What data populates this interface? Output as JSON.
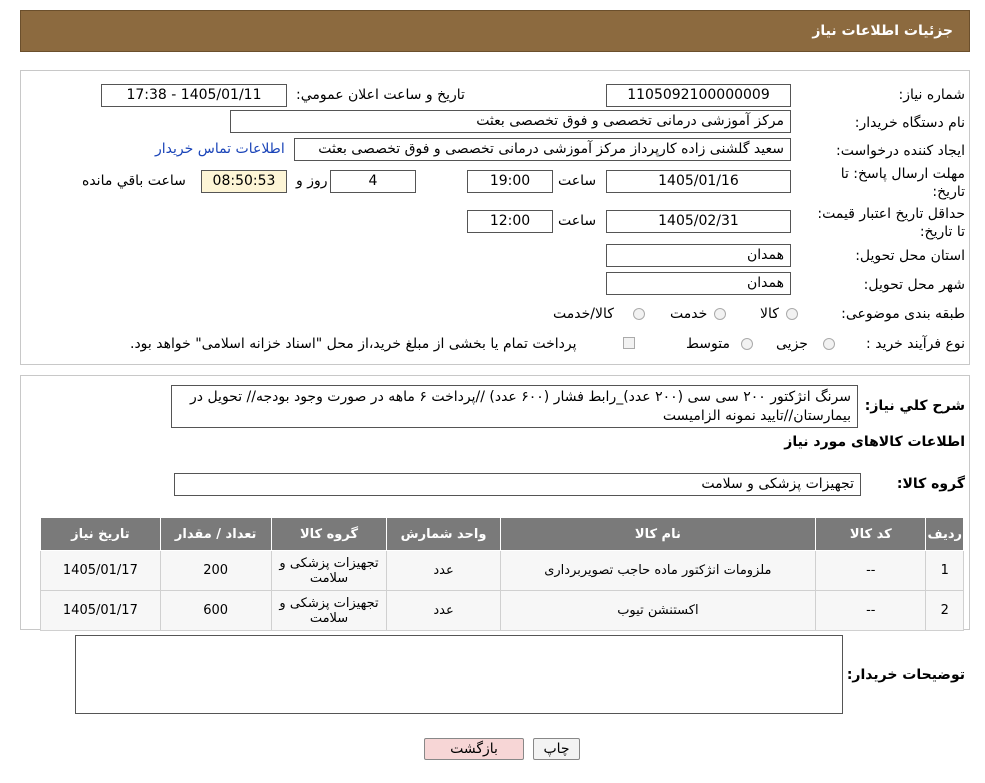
{
  "header": {
    "title": "جزئیات اطلاعات نیاز"
  },
  "form": {
    "need_number_label": "شماره نیاز:",
    "need_number": "1105092100000009",
    "announce_label": "تاریخ و ساعت اعلان عمومي:",
    "announce_value": "1405/01/11 - 17:38",
    "buyer_org_label": "نام دستگاه خريدار:",
    "buyer_org": "مرکز آموزشی درمانی تخصصی و فوق تخصصی بعثت",
    "creator_label": "ايجاد کننده درخواست:",
    "creator": "سعید گلشنی زاده کارپرداز مرکز آموزشی درمانی تخصصی و فوق تخصصی بعثت",
    "contact_link": "اطلاعات تماس خريدار",
    "deadline_label": "مهلت ارسال پاسخ: تا تاریخ:",
    "deadline_date": "1405/01/16",
    "time_label": "ساعت",
    "deadline_time": "19:00",
    "days_value": "4",
    "days_label": "روز و",
    "remaining_time": "08:50:53",
    "remaining_label": "ساعت باقي مانده",
    "validity_label": "حداقل تاريخ اعتبار قيمت: تا تاریخ:",
    "validity_date": "1405/02/31",
    "validity_time": "12:00",
    "province_label": "استان محل تحویل:",
    "province": "همدان",
    "city_label": "شهر محل تحویل:",
    "city": "همدان",
    "category_label": "طبقه بندی موضوعی:",
    "category_options": [
      "کالا",
      "خدمت",
      "کالا/خدمت"
    ],
    "process_label": "نوع فرآیند خرید :",
    "process_options": [
      "جزیی",
      "متوسط"
    ],
    "payment_note": "پرداخت تمام يا بخشی از مبلغ خريد،از محل \"اسناد خزانه اسلامی\" خواهد بود."
  },
  "description": {
    "label": "شرح کلي نياز:",
    "text": "سرنگ انژکتور ۲۰۰ سی سی (۲۰۰ عدد)_رابط فشار (۶۰۰ عدد) //پرداخت ۶ ماهه در صورت وجود بودجه// تحویل در بیمارستان//تایید نمونه الزامیست"
  },
  "goods": {
    "section_title": "اطلاعات کالاهای مورد نیاز",
    "group_label": "گروه کالا:",
    "group_value": "تجهیزات پزشکی و سلامت",
    "columns": [
      "رديف",
      "کد کالا",
      "نام کالا",
      "واحد شمارش",
      "گروه کالا",
      "تعداد / مقدار",
      "تاریخ نیاز"
    ],
    "rows": [
      {
        "row": "1",
        "code": "--",
        "name": "ملزومات انژکتور ماده حاجب تصویربرداری",
        "unit": "عدد",
        "group": "تجهیزات پزشکی و سلامت",
        "qty": "200",
        "date": "1405/01/17"
      },
      {
        "row": "2",
        "code": "--",
        "name": "اکستنشن تیوب",
        "unit": "عدد",
        "group": "تجهیزات پزشکی و سلامت",
        "qty": "600",
        "date": "1405/01/17"
      }
    ]
  },
  "buyer_notes": {
    "label": "توضیحات خریدار:",
    "value": ""
  },
  "buttons": {
    "print": "چاپ",
    "back": "بازگشت"
  },
  "colors": {
    "header": "#8c6a3f",
    "table_header": "#7a7a7a",
    "back_button": "#f7d6d6"
  }
}
